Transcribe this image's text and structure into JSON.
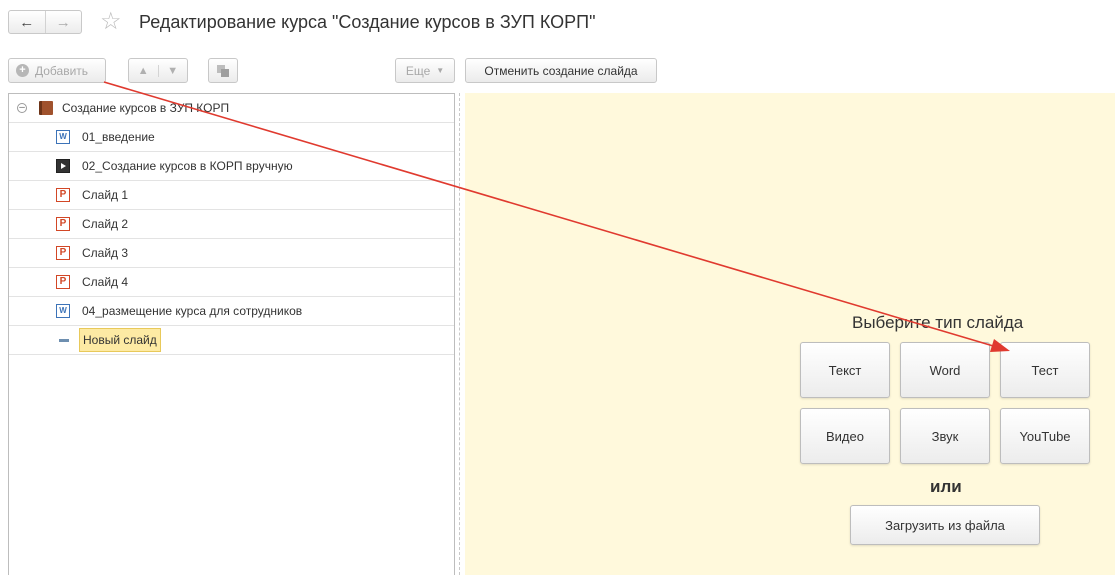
{
  "header": {
    "back_icon": "arrow-left-icon",
    "forward_icon": "arrow-right-icon",
    "favorite_icon": "star-icon",
    "title": "Редактирование курса \"Создание курсов в ЗУП КОРП\""
  },
  "toolbar": {
    "add_label": "Добавить",
    "more_label": "Еще",
    "cancel_label": "Отменить создание слайда"
  },
  "tree": {
    "root_label": "Создание курсов в ЗУП КОРП",
    "items": [
      {
        "label": "01_введение",
        "icon": "word-document-icon"
      },
      {
        "label": "02_Создание курсов в КОРП вручную",
        "icon": "video-icon"
      },
      {
        "label": "Слайд 1",
        "icon": "powerpoint-icon"
      },
      {
        "label": "Слайд 2",
        "icon": "powerpoint-icon"
      },
      {
        "label": "Слайд 3",
        "icon": "powerpoint-icon"
      },
      {
        "label": "Слайд 4",
        "icon": "powerpoint-icon"
      },
      {
        "label": "04_размещение курса для сотрудников",
        "icon": "word-document-icon"
      },
      {
        "label": "Новый слайд",
        "icon": "new-slide-icon",
        "selected": true
      }
    ]
  },
  "panel": {
    "choose_label": "Выберите тип слайда",
    "types": [
      "Текст",
      "Word",
      "Тест",
      "Видео",
      "Звук",
      "YouTube"
    ],
    "or_label": "или",
    "upload_label": "Загрузить из файла",
    "background": "#fff9dc"
  },
  "annotation": {
    "arrow_color": "#e03a2f"
  }
}
